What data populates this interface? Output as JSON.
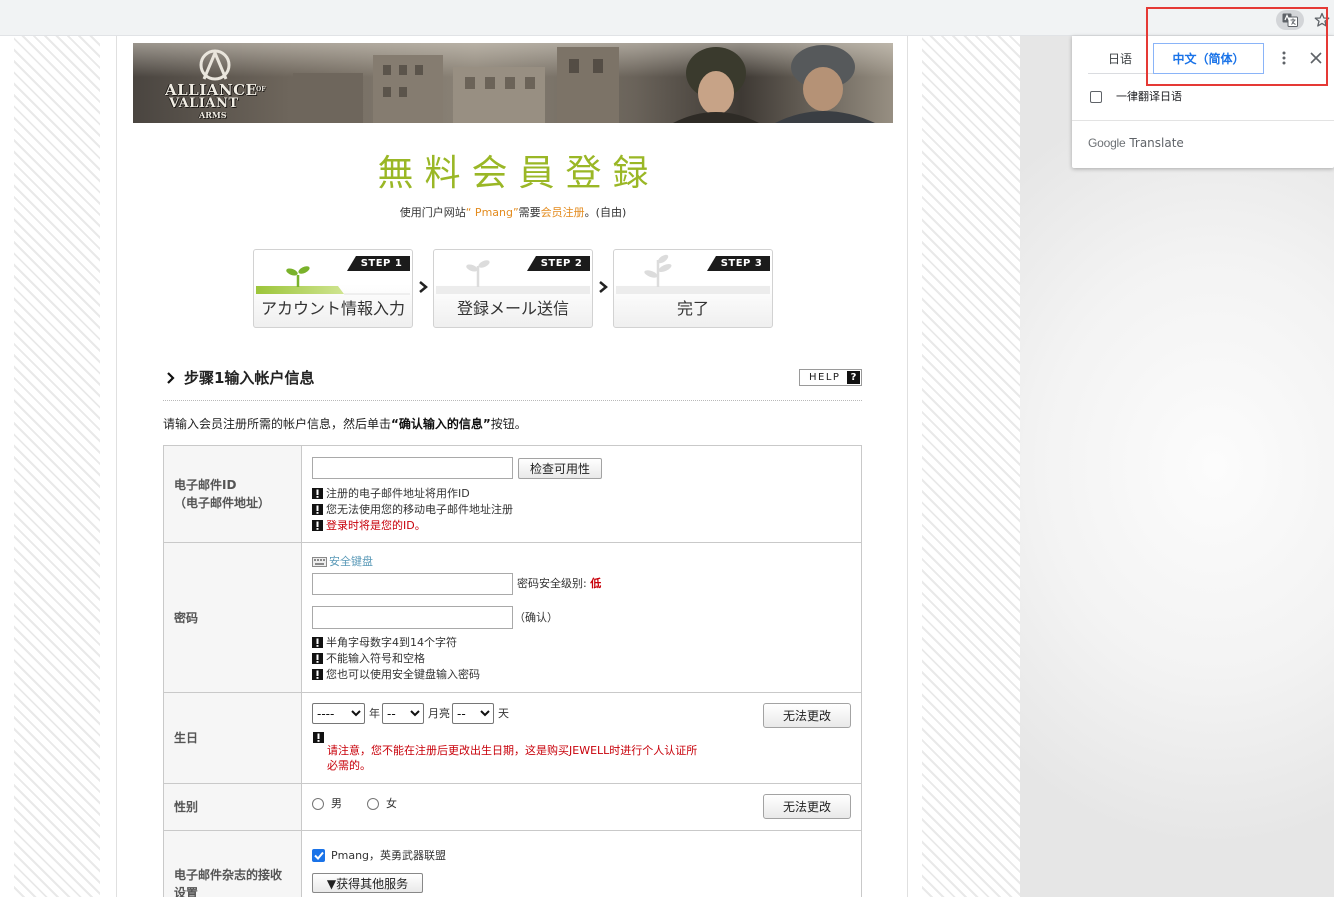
{
  "browser": {
    "translate_icon": "translate-icon",
    "bookmark_icon": "star-icon"
  },
  "banner": {
    "logo": {
      "alliance": "ALLIANCE",
      "of": "OF",
      "valiant": "VALIANT",
      "arms": "ARMS"
    }
  },
  "header": {
    "title": "無料会員登録",
    "subtitle": {
      "prefix": "使用门户网站",
      "portal": "“ Pmang”",
      "middle": "需要",
      "highlight": "会员注册",
      "suffix": "。(自由)"
    },
    "accent_color": "#9ab726",
    "highlight_color": "#e38b1e"
  },
  "steps": [
    {
      "tag": "STEP 1",
      "label": "アカウント情報入力",
      "active": true,
      "icon": "sprout-icon"
    },
    {
      "tag": "STEP 2",
      "label": "登録メール送信",
      "active": false,
      "icon": "sprout-icon"
    },
    {
      "tag": "STEP 3",
      "label": "完了",
      "active": false,
      "icon": "plant-icon"
    }
  ],
  "section": {
    "title": "步骤1输入帐户信息",
    "help_label": "HELP",
    "help_icon": "?",
    "instruction": {
      "before": "请输入会员注册所需的帐户信息，然后单击",
      "bold": "“确认输入的信息”",
      "after": "按钮。"
    }
  },
  "form": {
    "email": {
      "label_line1": "电子邮件ID",
      "label_line2": "（电子邮件地址）",
      "check_button": "检查可用性",
      "notes": [
        "注册的电子邮件地址将用作ID",
        "您无法使用您的移动电子邮件地址注册"
      ],
      "warning": "登录时将是您的ID。"
    },
    "password": {
      "label": "密码",
      "secure_keyboard_link": "安全键盘",
      "strength_label": "密码安全级别:",
      "strength_value": "低",
      "confirm_label": "（确认）",
      "notes": [
        "半角字母数字4到14个字符",
        "不能输入符号和空格",
        "您也可以使用安全键盘输入密码"
      ]
    },
    "birthday": {
      "label": "生日",
      "year": {
        "selected": "----",
        "unit": "年"
      },
      "month": {
        "selected": "--",
        "unit": "月亮"
      },
      "day": {
        "selected": "--",
        "unit": "天"
      },
      "locked_button": "无法更改",
      "warning": "请注意，您不能在注册后更改出生日期，这是购买JEWELL时进行个人认证所必需的。"
    },
    "gender": {
      "label": "性别",
      "options": [
        "男",
        "女"
      ],
      "locked_button": "无法更改"
    },
    "newsletter": {
      "label": "电子邮件杂志的接收设置",
      "checkbox_label": "Pmang，英勇武器联盟",
      "checked": true,
      "more_button": "▼获得其他服务"
    }
  },
  "translate_popup": {
    "tabs": [
      {
        "label": "日语",
        "selected": false
      },
      {
        "label": "中文（简体）",
        "selected": true
      }
    ],
    "always_translate": "一律翻译日语",
    "always_translate_checked": false,
    "footer_google": "Google",
    "footer_translate": "Translate",
    "accent_color": "#1a73e8"
  },
  "annotation": {
    "highlight_color": "#e53935"
  }
}
